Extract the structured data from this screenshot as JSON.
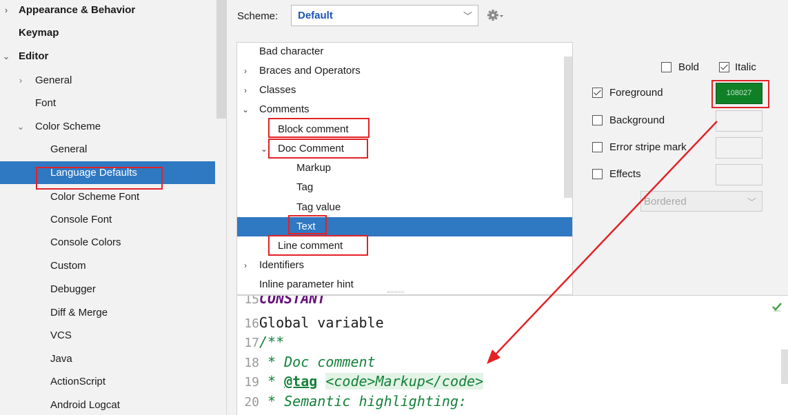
{
  "sidebar": {
    "items": [
      {
        "label": "Appearance & Behavior",
        "arrow": "›",
        "bold": true
      },
      {
        "label": "Keymap",
        "arrow": "",
        "bold": true
      },
      {
        "label": "Editor",
        "arrow": "⌄",
        "bold": true
      },
      {
        "label": "General",
        "arrow": "›",
        "bold": false
      },
      {
        "label": "Font",
        "arrow": "",
        "bold": false
      },
      {
        "label": "Color Scheme",
        "arrow": "⌄",
        "bold": false
      },
      {
        "label": "General",
        "arrow": "",
        "bold": false
      },
      {
        "label": "Language Defaults",
        "arrow": "",
        "bold": false,
        "selected": true
      },
      {
        "label": "Color Scheme Font",
        "arrow": "",
        "bold": false
      },
      {
        "label": "Console Font",
        "arrow": "",
        "bold": false
      },
      {
        "label": "Console Colors",
        "arrow": "",
        "bold": false
      },
      {
        "label": "Custom",
        "arrow": "",
        "bold": false
      },
      {
        "label": "Debugger",
        "arrow": "",
        "bold": false
      },
      {
        "label": "Diff & Merge",
        "arrow": "",
        "bold": false
      },
      {
        "label": "VCS",
        "arrow": "",
        "bold": false
      },
      {
        "label": "Java",
        "arrow": "",
        "bold": false
      },
      {
        "label": "ActionScript",
        "arrow": "",
        "bold": false
      },
      {
        "label": "Android Logcat",
        "arrow": "",
        "bold": false
      }
    ]
  },
  "scheme": {
    "label": "Scheme:",
    "value": "Default",
    "gear_icon": "gear-icon"
  },
  "tree": {
    "items": [
      {
        "label": "Bad character",
        "arrow": ""
      },
      {
        "label": "Braces and Operators",
        "arrow": "›"
      },
      {
        "label": "Classes",
        "arrow": "›"
      },
      {
        "label": "Comments",
        "arrow": "⌄"
      },
      {
        "label": "Block comment",
        "arrow": ""
      },
      {
        "label": "Doc Comment",
        "arrow": "⌄"
      },
      {
        "label": "Markup",
        "arrow": ""
      },
      {
        "label": "Tag",
        "arrow": ""
      },
      {
        "label": "Tag value",
        "arrow": ""
      },
      {
        "label": "Text",
        "arrow": "",
        "selected": true
      },
      {
        "label": "Line comment",
        "arrow": ""
      },
      {
        "label": "Identifiers",
        "arrow": "›"
      },
      {
        "label": "Inline parameter hint",
        "arrow": ""
      }
    ]
  },
  "attributes": {
    "bold": {
      "label": "Bold",
      "checked": false
    },
    "italic": {
      "label": "Italic",
      "checked": true
    },
    "foreground": {
      "label": "Foreground",
      "checked": true,
      "color": "108027",
      "color_hex": "#108027"
    },
    "background": {
      "label": "Background",
      "checked": false
    },
    "error_stripe": {
      "label": "Error stripe mark",
      "checked": false
    },
    "effects": {
      "label": "Effects",
      "checked": false,
      "type": "Bordered"
    }
  },
  "preview": {
    "lines": [
      {
        "num": "15",
        "text": "CONSTANT"
      },
      {
        "num": "16",
        "text": "Global variable"
      },
      {
        "num": "17",
        "text": "/**"
      },
      {
        "num": "18",
        "text": " * Doc comment"
      },
      {
        "num": "19",
        "prefix": " * ",
        "tag": "@tag",
        "markup": "<code>Markup</code>"
      },
      {
        "num": "20",
        "text": " * Semantic highlighting:"
      }
    ]
  },
  "colors": {
    "selection": "#2f78c2",
    "annotation_red": "#e32125",
    "comment_green": "#13813a"
  }
}
